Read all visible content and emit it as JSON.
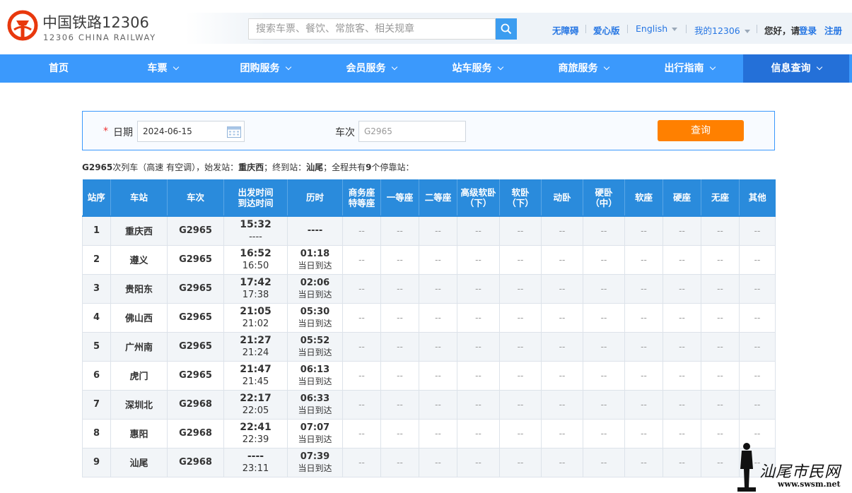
{
  "header": {
    "logo_cn": "中国铁路12306",
    "logo_en": "12306 CHINA RAILWAY",
    "search_placeholder": "搜索车票、餐饮、常旅客、相关规章",
    "links": {
      "accessible": "无障碍",
      "elder": "爱心版",
      "english": "English",
      "my": "我的12306",
      "greeting": "您好，请",
      "login": "登录",
      "register": "注册"
    }
  },
  "nav": [
    "首页",
    "车票",
    "团购服务",
    "会员服务",
    "站车服务",
    "商旅服务",
    "出行指南",
    "信息查询"
  ],
  "query": {
    "required_mark": "*",
    "date_label": "日期",
    "date_value": "2024-06-15",
    "train_label": "车次",
    "train_placeholder": "G2965",
    "submit": "查询"
  },
  "summary": {
    "train": "G2965",
    "text1": "次列车（高速 有空调），始发站：",
    "origin": "重庆西",
    "text2": "；终到站：",
    "terminal": "汕尾",
    "text3": "；全程共有",
    "count": "9",
    "text4": "个停靠站："
  },
  "table": {
    "headers": [
      "站序",
      "车站",
      "车次",
      "出发时间\n到达时间",
      "历时",
      "商务座\n特等座",
      "一等座",
      "二等座",
      "高级软卧\n（下）",
      "软卧\n（下）",
      "动卧",
      "硬卧\n（中）",
      "软座",
      "硬座",
      "无座",
      "其他"
    ],
    "seat_placeholder": "--",
    "rows": [
      {
        "no": "1",
        "station": "重庆西",
        "train": "G2965",
        "dep": "15:32",
        "arr": "----",
        "dur": "----",
        "day": ""
      },
      {
        "no": "2",
        "station": "遵义",
        "train": "G2965",
        "dep": "16:52",
        "arr": "16:50",
        "dur": "01:18",
        "day": "当日到达"
      },
      {
        "no": "3",
        "station": "贵阳东",
        "train": "G2965",
        "dep": "17:42",
        "arr": "17:38",
        "dur": "02:06",
        "day": "当日到达"
      },
      {
        "no": "4",
        "station": "佛山西",
        "train": "G2965",
        "dep": "21:05",
        "arr": "21:02",
        "dur": "05:30",
        "day": "当日到达"
      },
      {
        "no": "5",
        "station": "广州南",
        "train": "G2965",
        "dep": "21:27",
        "arr": "21:24",
        "dur": "05:52",
        "day": "当日到达"
      },
      {
        "no": "6",
        "station": "虎门",
        "train": "G2965",
        "dep": "21:47",
        "arr": "21:45",
        "dur": "06:13",
        "day": "当日到达"
      },
      {
        "no": "7",
        "station": "深圳北",
        "train": "G2968",
        "dep": "22:17",
        "arr": "22:05",
        "dur": "06:33",
        "day": "当日到达"
      },
      {
        "no": "8",
        "station": "惠阳",
        "train": "G2968",
        "dep": "22:41",
        "arr": "22:39",
        "dur": "07:07",
        "day": "当日到达"
      },
      {
        "no": "9",
        "station": "汕尾",
        "train": "G2968",
        "dep": "----",
        "arr": "23:11",
        "dur": "07:39",
        "day": "当日到达"
      }
    ]
  },
  "watermark": {
    "text": "汕尾市民网",
    "url": "www.swsm.net"
  },
  "colors": {
    "nav_blue": "#3b99fc",
    "nav_active": "#2470d8",
    "table_header": "#2a8bdc",
    "button_orange": "#ff8000",
    "link_blue": "#2676e3"
  }
}
